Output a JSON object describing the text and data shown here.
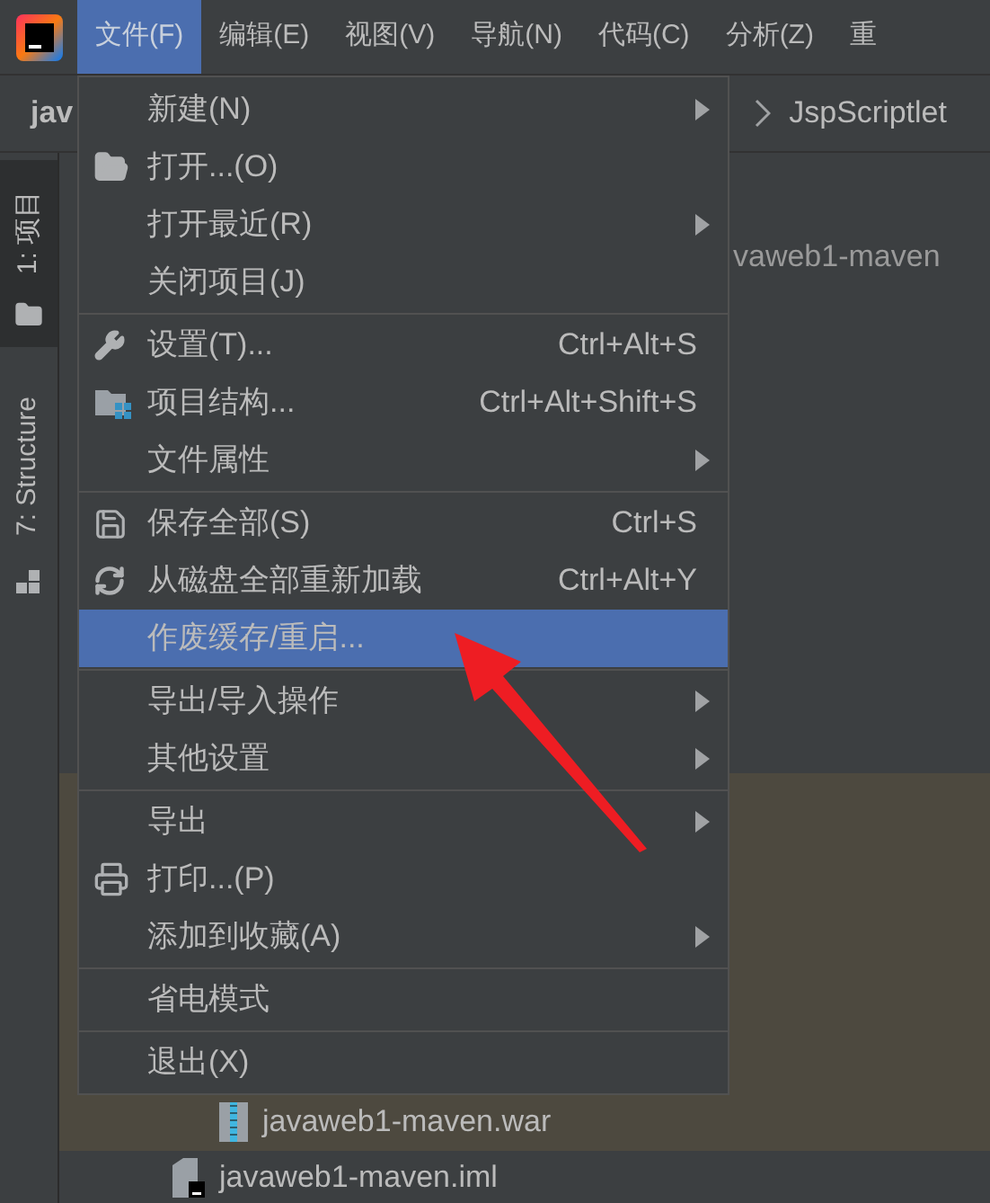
{
  "menubar": {
    "items": [
      {
        "label": "文件(F)",
        "selected": true
      },
      {
        "label": "编辑(E)",
        "selected": false
      },
      {
        "label": "视图(V)",
        "selected": false
      },
      {
        "label": "导航(N)",
        "selected": false
      },
      {
        "label": "代码(C)",
        "selected": false
      },
      {
        "label": "分析(Z)",
        "selected": false
      },
      {
        "label": "重",
        "selected": false
      }
    ]
  },
  "breadcrumb": {
    "path_start": "jav",
    "current": "JspScriptlet"
  },
  "side_tabs": [
    {
      "label": "1: 项目",
      "selected": true
    },
    {
      "label": "7: Structure",
      "selected": false
    }
  ],
  "project_tree": {
    "root_label": "vaweb1-maven",
    "rows": [
      {
        "label": "javaweb1-maven.war",
        "kind": "archive",
        "selected": true
      },
      {
        "label": "javaweb1-maven.iml",
        "kind": "module-file",
        "selected": false
      }
    ]
  },
  "file_menu": {
    "sections": [
      [
        {
          "label": "新建(N)",
          "submenu": true,
          "selected": false
        },
        {
          "label": "打开...(O)",
          "submenu": false,
          "selected": false
        },
        {
          "label": "打开最近(R)",
          "submenu": true,
          "selected": false
        },
        {
          "label": "关闭项目(J)",
          "submenu": false,
          "selected": false
        }
      ],
      [
        {
          "label": "设置(T)...",
          "shortcut": "Ctrl+Alt+S",
          "submenu": false,
          "selected": false
        },
        {
          "label": "项目结构...",
          "shortcut": "Ctrl+Alt+Shift+S",
          "submenu": false,
          "selected": false
        },
        {
          "label": "文件属性",
          "submenu": true,
          "selected": false
        }
      ],
      [
        {
          "label": "保存全部(S)",
          "shortcut": "Ctrl+S",
          "submenu": false,
          "selected": false
        },
        {
          "label": "从磁盘全部重新加载",
          "shortcut": "Ctrl+Alt+Y",
          "submenu": false,
          "selected": false
        },
        {
          "label": "作废缓存/重启...",
          "submenu": false,
          "selected": true
        }
      ],
      [
        {
          "label": "导出/导入操作",
          "submenu": true,
          "selected": false
        },
        {
          "label": "其他设置",
          "submenu": true,
          "selected": false
        }
      ],
      [
        {
          "label": "导出",
          "submenu": true,
          "selected": false
        },
        {
          "label": "打印...(P)",
          "submenu": false,
          "selected": false
        },
        {
          "label": "添加到收藏(A)",
          "submenu": true,
          "selected": false
        }
      ],
      [
        {
          "label": "省电模式",
          "submenu": false,
          "selected": false
        }
      ],
      [
        {
          "label": "退出(X)",
          "submenu": false,
          "selected": false
        }
      ]
    ]
  }
}
